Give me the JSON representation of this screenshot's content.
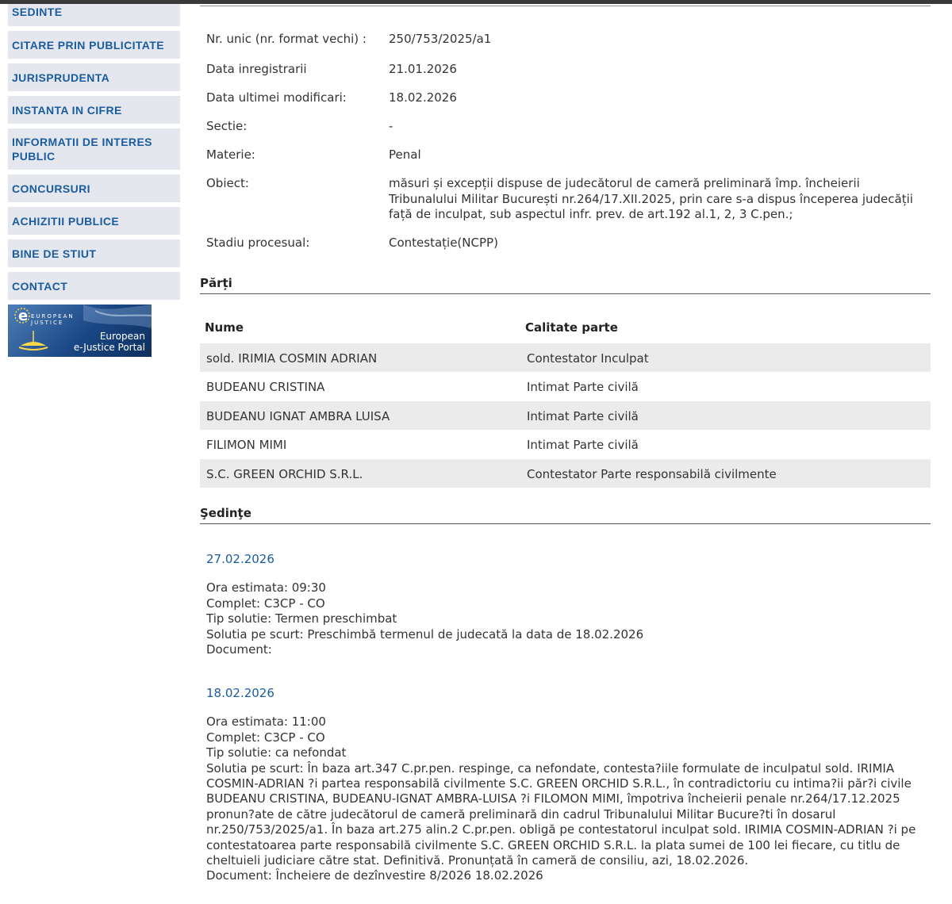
{
  "sidebar": {
    "items": [
      {
        "label": "SEDINTE"
      },
      {
        "label": "CITARE PRIN PUBLICITATE"
      },
      {
        "label": "JURISPRUDENTA"
      },
      {
        "label": "INSTANTA IN CIFRE"
      },
      {
        "label": "INFORMATII DE INTERES PUBLIC"
      },
      {
        "label": "CONCURSURI"
      },
      {
        "label": "ACHIZITII PUBLICE"
      },
      {
        "label": "BINE DE STIUT"
      },
      {
        "label": "CONTACT"
      }
    ],
    "ejustice": {
      "small_line1": "EUROPEAN",
      "small_line2": "JUSTICE",
      "line1": "European",
      "line2": "e-Justice Portal"
    }
  },
  "case": {
    "fields": [
      {
        "label": "Nr. unic (nr. format vechi) :",
        "value": "250/753/2025/a1"
      },
      {
        "label": "Data inregistrarii",
        "value": "21.01.2026"
      },
      {
        "label": "Data ultimei modificari:",
        "value": "18.02.2026"
      },
      {
        "label": "Sectie:",
        "value": "-"
      },
      {
        "label": "Materie:",
        "value": "Penal"
      },
      {
        "label": "Obiect:",
        "value": "măsuri și excepții dispuse de judecătorul de cameră preliminară împ. încheierii Tribunalului Militar București nr.264/17.XII.2025, prin care s-a dispus începerea judecății față de inculpat, sub aspectul infr. prev. de art.192 al.1, 2, 3 C.pen.;"
      },
      {
        "label": "Stadiu procesual:",
        "value": "Contestație(NCPP)"
      }
    ]
  },
  "parties": {
    "title": "Părți",
    "headers": {
      "name": "Nume",
      "role": "Calitate parte"
    },
    "rows": [
      {
        "name": "sold. IRIMIA COSMIN ADRIAN",
        "role": "Contestator Inculpat"
      },
      {
        "name": "BUDEANU CRISTINA",
        "role": "Intimat Parte civilă"
      },
      {
        "name": "BUDEANU IGNAT AMBRA LUISA",
        "role": "Intimat Parte civilă"
      },
      {
        "name": "FILIMON MIMI",
        "role": "Intimat Parte civilă"
      },
      {
        "name": "S.C. GREEN ORCHID S.R.L.",
        "role": "Contestator Parte responsabilă civilmente"
      }
    ]
  },
  "sessions": {
    "title": "Şedinţe",
    "items": [
      {
        "date": "27.02.2026",
        "ora": "Ora estimata: 09:30",
        "complet": "Complet: C3CP - CO",
        "tip": "Tip solutie: Termen preschimbat",
        "solutia": "Solutia pe scurt: Preschimbă termenul de judecată la data de 18.02.2026",
        "document": "Document:"
      },
      {
        "date": "18.02.2026",
        "ora": "Ora estimata: 11:00",
        "complet": "Complet: C3CP - CO",
        "tip": "Tip solutie: ca nefondat",
        "solutia": "Solutia pe scurt: În baza art.347 C.pr.pen. respinge, ca nefondate, contesta?iile formulate de inculpatul sold. IRIMIA COSMIN-ADRIAN ?i partea responsabilă civilmente S.C. GREEN ORCHID S.R.L., în contradictoriu cu intima?ii păr?i civile BUDEANU CRISTINA, BUDEANU-IGNAT AMBRA-LUISA ?i FILOMON MIMI, împotriva încheierii penale nr.264/17.12.2025 pronun?ate de către judecătorul de cameră preliminară din cadrul Tribunalului Militar Bucure?ti în dosarul nr.250/753/2025/a1. În baza art.275 alin.2 C.pr.pen. obligă pe contestatorul inculpat sold. IRIMIA COSMIN-ADRIAN ?i pe contestatoarea parte responsabilă civilmente S.C. GREEN ORCHID S.R.L. la plata sumei de 100 lei fiecare, cu titlu de cheltuieli judiciare către stat. Definitivă. Pronunțată în cameră de consiliu, azi, 18.02.2026.",
        "document": "Document: Încheiere de dezînvestire  8/2026  18.02.2026"
      }
    ]
  },
  "colors": {
    "nav_text": "#1a5c9e",
    "nav_bg": "#e4e8ee",
    "link": "#1a5c9e",
    "row_shade": "#ebebeb"
  }
}
